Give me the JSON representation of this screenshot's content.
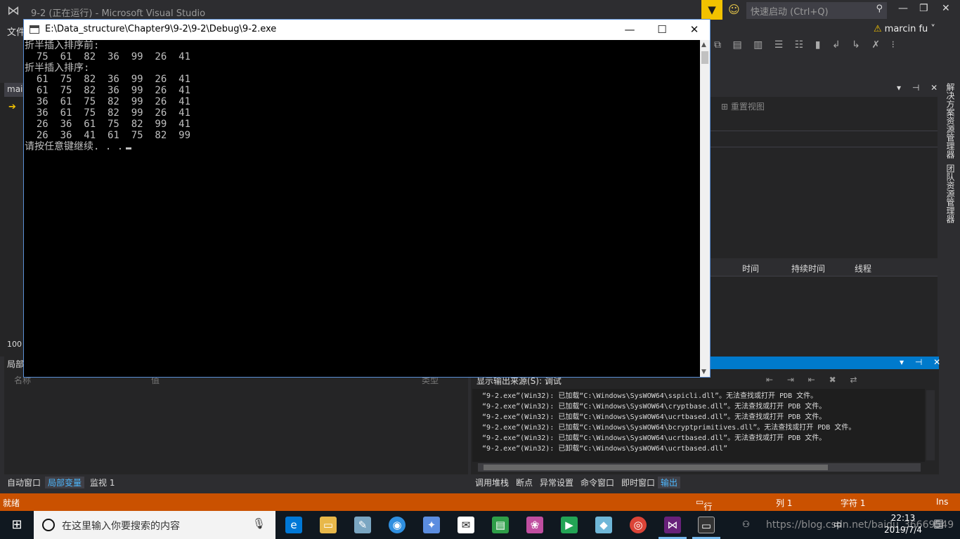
{
  "vs": {
    "title": "9-2 (正在运行) - Microsoft Visual Studio",
    "quick_launch": "快速启动 (Ctrl+Q)",
    "menu_first": "文件",
    "user": "marcin fu",
    "left_tab": "mai",
    "zoom": "100 %",
    "reset_view": "重置视图",
    "solution_explorer_tab": "解决方案资源管理器",
    "team_explorer_tab": "团队资源管理器",
    "diag_columns": [
      "时间",
      "持续时间",
      "线程"
    ],
    "locals": {
      "title": "局部变量",
      "col_name": "名称",
      "col_value": "值",
      "col_type": "类型"
    },
    "bottom_left_tabs": [
      "自动窗口",
      "局部变量",
      "监视 1"
    ],
    "output": {
      "source_label": "显示输出来源(S):",
      "source_value": "调试",
      "lines": [
        "“9-2.exe”(Win32): 已加载“C:\\Windows\\SysWOW64\\sspicli.dll”。无法查找或打开 PDB 文件。",
        "“9-2.exe”(Win32): 已加载“C:\\Windows\\SysWOW64\\cryptbase.dll”。无法查找或打开 PDB 文件。",
        "“9-2.exe”(Win32): 已加载“C:\\Windows\\SysWOW64\\ucrtbased.dll”。无法查找或打开 PDB 文件。",
        "“9-2.exe”(Win32): 已加载“C:\\Windows\\SysWOW64\\bcryptprimitives.dll”。无法查找或打开 PDB 文件。",
        "“9-2.exe”(Win32): 已加载“C:\\Windows\\SysWOW64\\ucrtbased.dll”。无法查找或打开 PDB 文件。",
        "“9-2.exe”(Win32): 已卸载“C:\\Windows\\SysWOW64\\ucrtbased.dll”"
      ]
    },
    "bottom_right_tabs": [
      "调用堆栈",
      "断点",
      "异常设置",
      "命令窗口",
      "即时窗口",
      "输出"
    ],
    "status": {
      "ready": "就绪",
      "line": "行 1",
      "col": "列 1",
      "char": "字符 1",
      "ins": "Ins"
    }
  },
  "console": {
    "title": "E:\\Data_structure\\Chapter9\\9-2\\9-2\\Debug\\9-2.exe",
    "lines": [
      "折半插入排序前:",
      "  75  61  82  36  99  26  41",
      "折半插入排序:",
      "  61  75  82  36  99  26  41",
      "  61  75  82  36  99  26  41",
      "  36  61  75  82  99  26  41",
      "  36  61  75  82  99  26  41",
      "  26  36  61  75  82  99  41",
      "  26  36  41  61  75  82  99",
      "请按任意键继续. . ."
    ]
  },
  "taskbar": {
    "search_placeholder": "在这里输入你要搜索的内容",
    "time": "22:13",
    "date": "2019/7/4",
    "ime": "中",
    "watermark": "https://blog.csdn.net/baidu_36669549"
  }
}
